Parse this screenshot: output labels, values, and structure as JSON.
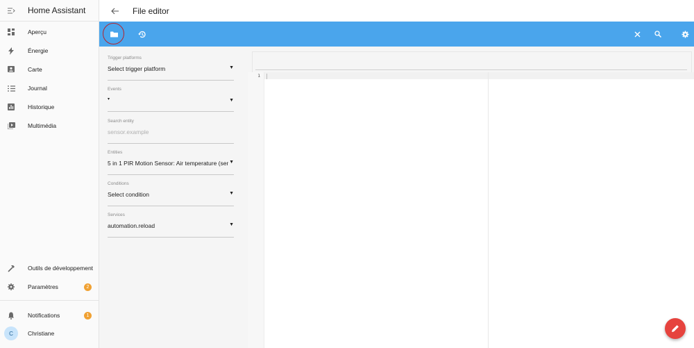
{
  "sidebar": {
    "title": "Home Assistant",
    "items": [
      {
        "label": "Aperçu",
        "icon": "dashboard-icon"
      },
      {
        "label": "Énergie",
        "icon": "lightning-icon"
      },
      {
        "label": "Carte",
        "icon": "map-icon"
      },
      {
        "label": "Journal",
        "icon": "list-icon"
      },
      {
        "label": "Historique",
        "icon": "chart-icon"
      },
      {
        "label": "Multimédia",
        "icon": "media-icon"
      }
    ],
    "bottom": [
      {
        "label": "Outils de développement",
        "icon": "hammer-icon"
      },
      {
        "label": "Paramètres",
        "icon": "gear-icon",
        "badge": "2"
      }
    ],
    "notifications": {
      "label": "Notifications",
      "badge": "1"
    },
    "user": {
      "label": "Christiane",
      "initial": "C"
    }
  },
  "header": {
    "title": "File editor"
  },
  "panel": {
    "fields": [
      {
        "label": "Trigger platforms",
        "value": "Select trigger platform"
      },
      {
        "label": "Events",
        "value": "▾"
      },
      {
        "label": "Search entity",
        "placeholder": "sensor.example"
      },
      {
        "label": "Entities",
        "value": "5 in 1 PIR Motion Sensor: Air temperature (sens..."
      },
      {
        "label": "Conditions",
        "value": "Select condition"
      },
      {
        "label": "Services",
        "value": "automation.reload"
      }
    ]
  },
  "editor": {
    "line_numbers": [
      "1"
    ]
  },
  "colors": {
    "toolbar": "#4aa5ec",
    "fab": "#e6433e",
    "badge": "#f0a133",
    "highlight_ring": "#b3242d"
  }
}
